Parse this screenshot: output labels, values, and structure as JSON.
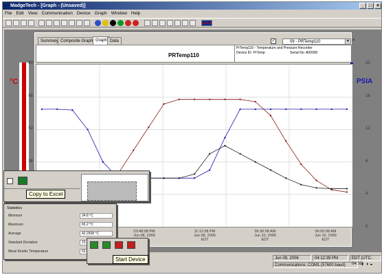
{
  "window": {
    "title": "MadgeTech - [Graph - (Unsaved)]"
  },
  "menu": [
    "File",
    "Edit",
    "View",
    "Communication",
    "Device",
    "Graph",
    "Window",
    "Help"
  ],
  "tabs": [
    {
      "label": "Summary"
    },
    {
      "label": "Composite Graph"
    },
    {
      "label": "Graph"
    },
    {
      "label": "Data"
    }
  ],
  "device_selector": {
    "value": "09 - PRTemp110"
  },
  "header": {
    "title": "PRTemp110",
    "line1": "PrTemp110 - Temperature and Pressure Recorder",
    "device_id": "Device ID: PrTemp",
    "serial": "Serial No: A00000"
  },
  "left_axis": {
    "unit": "°C",
    "color": "#cc0000",
    "ticks": [
      "80",
      "65",
      "52",
      "38",
      "24",
      "10"
    ]
  },
  "right_axis": {
    "unit": "PSIA",
    "color": "#1a1aaa",
    "ticks": [
      "20",
      "16",
      "12",
      "8",
      "4",
      "0"
    ]
  },
  "x_axis": {
    "ticks": [
      {
        "l1": "03:48:08 PM",
        "l2": "Jun 08, 2006",
        "l3": "EDT"
      },
      {
        "l1": "11:12:08 PM",
        "l2": "Jun 08, 2006",
        "l3": "EDT"
      },
      {
        "l1": "06:36:08 AM",
        "l2": "Jun 10, 2006",
        "l3": "EDT"
      },
      {
        "l1": "06:00:08 AM",
        "l2": "Jun 10, 2006",
        "l3": "EDT"
      }
    ]
  },
  "chart_data": {
    "type": "line",
    "ylim_left": [
      10,
      80
    ],
    "ylim_right": [
      0,
      20
    ],
    "x": [
      0,
      1,
      2,
      3,
      4,
      5,
      6,
      7,
      8,
      9,
      10,
      11,
      12,
      13,
      14,
      15,
      16,
      17,
      18,
      19,
      20
    ],
    "series": [
      {
        "color": "#8b2020",
        "values": [
          24,
          24,
          24,
          25,
          27,
          33,
          43,
          53,
          63,
          65,
          65,
          65,
          65,
          65,
          64,
          58,
          47,
          37,
          30,
          26,
          25
        ]
      },
      {
        "color": "#1a1aaa",
        "values": [
          14.5,
          14.5,
          14.4,
          12,
          8,
          6,
          6,
          6,
          6,
          6,
          6,
          7,
          11,
          14.5,
          14.5,
          14.5,
          14.5,
          14.5,
          14.5,
          14.5,
          14.5
        ]
      },
      {
        "color": "#222222",
        "values": [
          6,
          6,
          6,
          6,
          6,
          6,
          6,
          6,
          6,
          6,
          6.5,
          9,
          10,
          9,
          8,
          7,
          6,
          5.2,
          4.8,
          4.7,
          4.7
        ]
      }
    ]
  },
  "copy_popup": {
    "tooltip": "Copy to Excel"
  },
  "stats": {
    "title": "Statistics",
    "rows": [
      {
        "label": "Minimum",
        "value": "24.8 °C"
      },
      {
        "label": "Maximum",
        "value": "65.2 °C"
      },
      {
        "label": "Average",
        "value": "42.2928 °C"
      },
      {
        "label": "Standard Deviation",
        "value": "15.9522 °C"
      },
      {
        "label": "Mean Kinetic Temperature",
        "value": "52.648 °C"
      }
    ]
  },
  "start_popup": {
    "tooltip": "Start Device"
  },
  "status": {
    "date": "Jun 09, 2006",
    "time": "04:12:39 PM",
    "tz": "EDT (UTC-04:00)",
    "comm": "Communications: COM1 (57600 baud)"
  }
}
